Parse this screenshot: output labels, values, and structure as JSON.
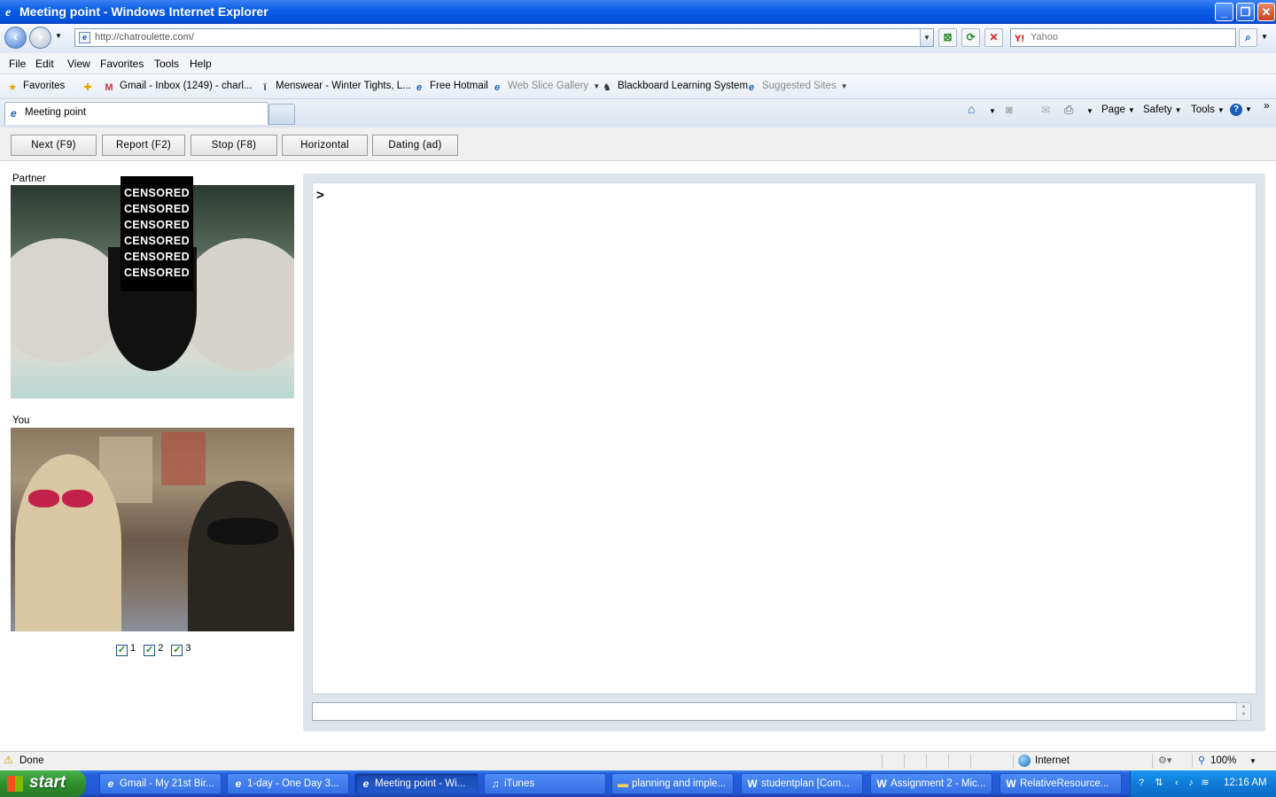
{
  "window": {
    "title": "Meeting point - Windows Internet Explorer",
    "min": "_",
    "max": "❐",
    "close": "✕"
  },
  "address": {
    "url": "http://chatroulette.com/",
    "search_placeholder": "Yahoo",
    "search_brand": "Y!"
  },
  "menu": [
    "File",
    "Edit",
    "View",
    "Favorites",
    "Tools",
    "Help"
  ],
  "favorites": {
    "label": "Favorites",
    "items": [
      "Gmail - Inbox (1249) - charl...",
      "Menswear - Winter Tights, L...",
      "Free Hotmail",
      "Web Slice Gallery",
      "Blackboard Learning System",
      "Suggested Sites"
    ]
  },
  "tab": {
    "title": "Meeting point"
  },
  "command_bar": {
    "page": "Page",
    "safety": "Safety",
    "tools": "Tools"
  },
  "buttons": [
    "Next (F9)",
    "Report (F2)",
    "Stop (F8)",
    "Horizontal",
    "Dating (ad)"
  ],
  "partner": {
    "label": "Partner",
    "censor_text": [
      "CENSORED",
      "CENSORED",
      "CENSORED",
      "CENSORED",
      "CENSORED",
      "CENSORED"
    ]
  },
  "you": {
    "label": "You"
  },
  "checkboxes": [
    {
      "label": "1",
      "checked": true
    },
    {
      "label": "2",
      "checked": true
    },
    {
      "label": "3",
      "checked": true
    }
  ],
  "chat": {
    "prompt": ">",
    "input_value": ""
  },
  "status": {
    "text": "Done",
    "zone": "Internet",
    "zoom": "100%"
  },
  "taskbar": {
    "start": "start",
    "tasks": [
      "Gmail - My 21st Bir...",
      "1-day - One Day 3...",
      "Meeting point - Wi...",
      "iTunes",
      "planning and imple...",
      "studentplan [Com...",
      "Assignment 2 - Mic...",
      "RelativeResource..."
    ],
    "clock": "12:16 AM"
  },
  "colors": {
    "titlebar": "#0c5ee6",
    "taskbar": "#245edb",
    "start": "#2f8f2f",
    "tray": "#0f7cd8",
    "chat_frame": "#dfe4ea"
  }
}
